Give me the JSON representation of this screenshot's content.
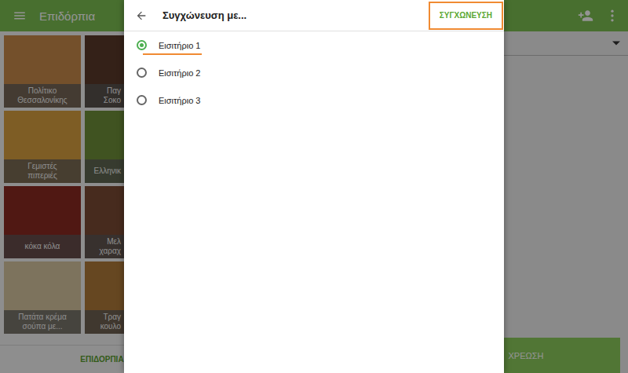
{
  "toolbar": {
    "title": "Επιδόρπια"
  },
  "tiles": [
    {
      "lines": [
        "Πολίτικο",
        "Θεσσαλονίκης"
      ],
      "color": "#c98a4b"
    },
    {
      "lines": [
        "Παγ",
        "Σοκο"
      ],
      "color": "#5a3a2a"
    },
    {
      "lines": [
        "Γεμιστές",
        "πιπεριές"
      ],
      "color": "#d9a040"
    },
    {
      "lines": [
        "Ελληνικ"
      ],
      "color": "#6f8f3a"
    },
    {
      "lines": [
        "κόκα κόλα"
      ],
      "color": "#8a2a22"
    },
    {
      "lines": [
        "Μελ",
        "χαραχ"
      ],
      "color": "#7a4a35"
    },
    {
      "lines": [
        "Πατάτα κρέμα",
        "σούπα με..."
      ],
      "color": "#d8c7a0"
    },
    {
      "lines": [
        "Τραγ",
        "κουλο"
      ],
      "color": "#b07a3a"
    }
  ],
  "tabs": [
    {
      "label": "ΕΠΙΔΟΡΠΙΑ",
      "selected": true
    }
  ],
  "charge_button": "ΧΡΕΩΣΗ",
  "dialog": {
    "title": "Συγχώνευση με...",
    "action": "ΣΥΓΧΩΝΕΥΣΗ",
    "options": [
      {
        "label": "Εισιτήριο 1",
        "selected": true
      },
      {
        "label": "Εισιτήριο 2",
        "selected": false
      },
      {
        "label": "Εισιτήριο 3",
        "selected": false
      }
    ]
  }
}
